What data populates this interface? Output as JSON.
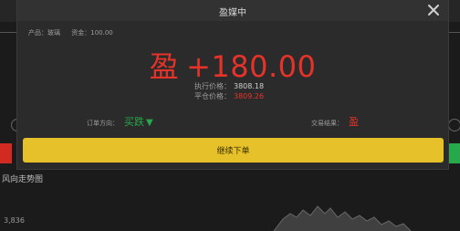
{
  "modal": {
    "title": "盈媒中",
    "summary": {
      "product": "产品：玻璃",
      "amount": "资金：100.00"
    },
    "result": {
      "tag": "盈",
      "amount": "+180.00"
    },
    "exec_price_label": "执行价格：",
    "exec_price_value": "3808.18",
    "close_price_label": "平仓价格：",
    "close_price_value": "3809.26",
    "order_direction_label": "订单方向：",
    "order_direction_value": "买跌",
    "order_result_label": "交易结果：",
    "order_result_value": "盈",
    "continue_label": "继续下单"
  },
  "background": {
    "chart_title": "风向走势图",
    "price_label": "3,836"
  },
  "colors": {
    "profit_red": "#e5332a",
    "direction_green": "#27a84a",
    "button_yellow": "#e7c12a"
  }
}
